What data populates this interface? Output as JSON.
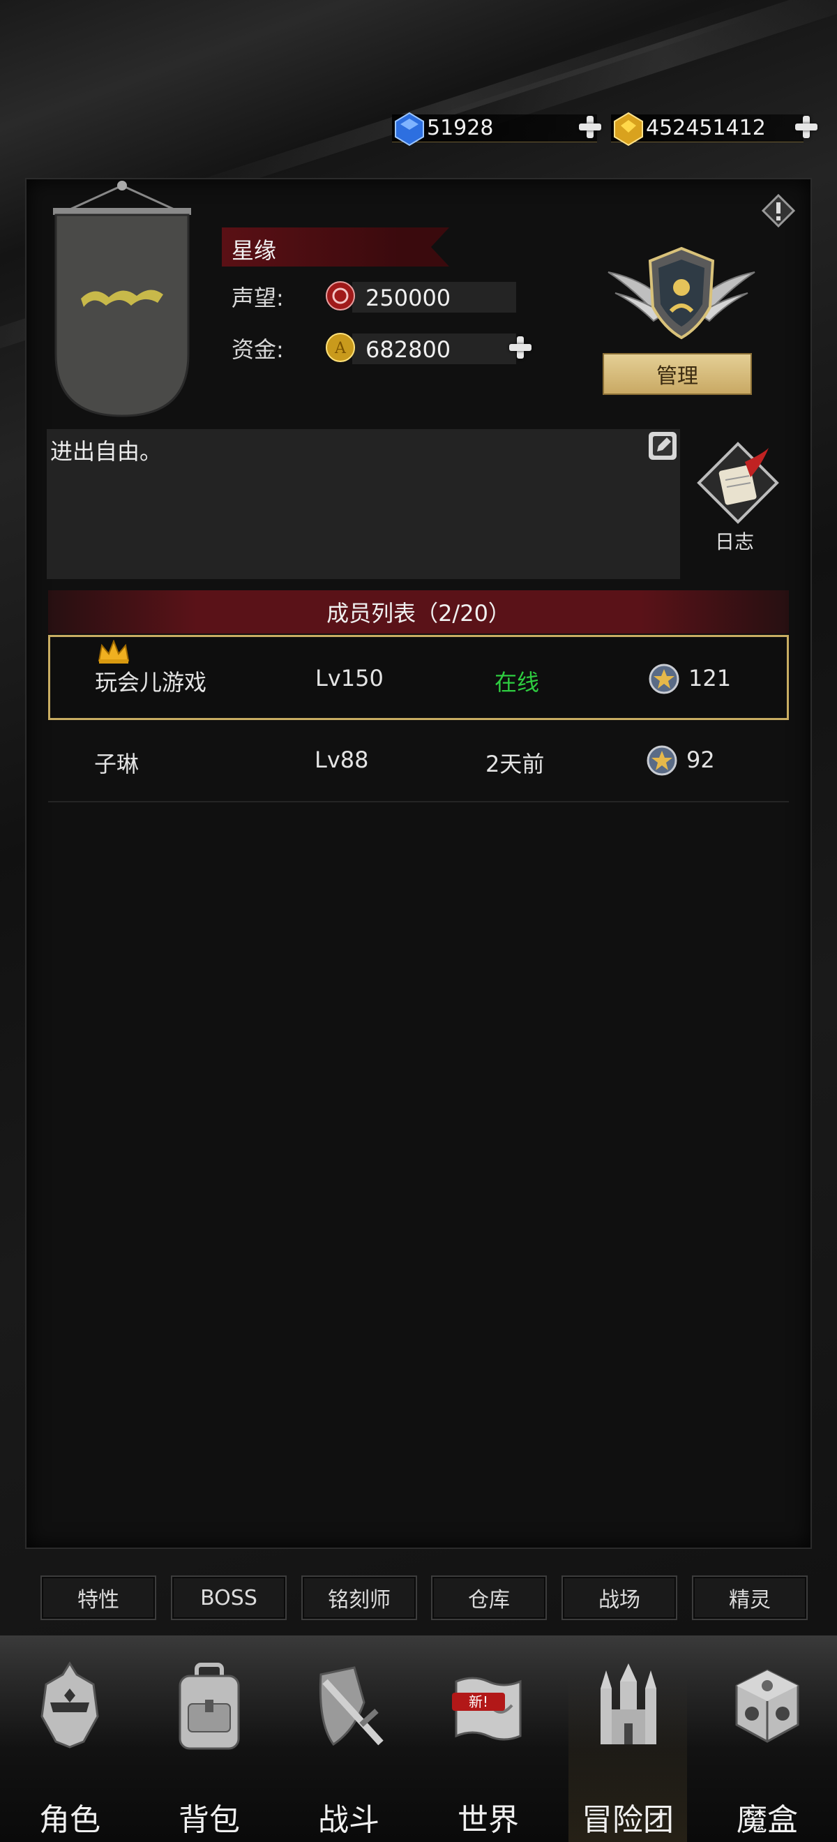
{
  "currency": {
    "diamond": "51928",
    "gold": "452451412"
  },
  "guild": {
    "name": "星缘",
    "reputation_label": "声望:",
    "reputation": "250000",
    "funds_label": "资金:",
    "funds": "682800",
    "manage_label": "管理",
    "notice": "进出自由。",
    "log_label": "日志"
  },
  "members": {
    "header": "成员列表（2/20）",
    "rows": [
      {
        "name": "玩会儿游戏",
        "level": "Lv150",
        "status": "在线",
        "score": "121"
      },
      {
        "name": "子琳",
        "level": "Lv88",
        "status": "2天前",
        "score": "92"
      }
    ]
  },
  "quick_buttons": [
    "特性",
    "BOSS",
    "铭刻师",
    "仓库",
    "战场",
    "精灵"
  ],
  "nav": {
    "items": [
      "角色",
      "背包",
      "战斗",
      "世界",
      "冒险团",
      "魔盒"
    ],
    "active_index": 4,
    "new_badge": "新!"
  },
  "colors": {
    "accent_gold": "#c9ad62",
    "ribbon_red": "#5a1218",
    "online_green": "#2ecc40"
  },
  "icons": {
    "diamond": "blue-gem-icon",
    "gold": "gold-gem-icon",
    "reputation": "reputation-coin-icon",
    "funds": "gold-coin-icon",
    "crown": "crown-icon",
    "medal": "star-medal-icon",
    "warning": "warning-icon",
    "edit": "edit-icon",
    "log": "scroll-quill-icon"
  }
}
